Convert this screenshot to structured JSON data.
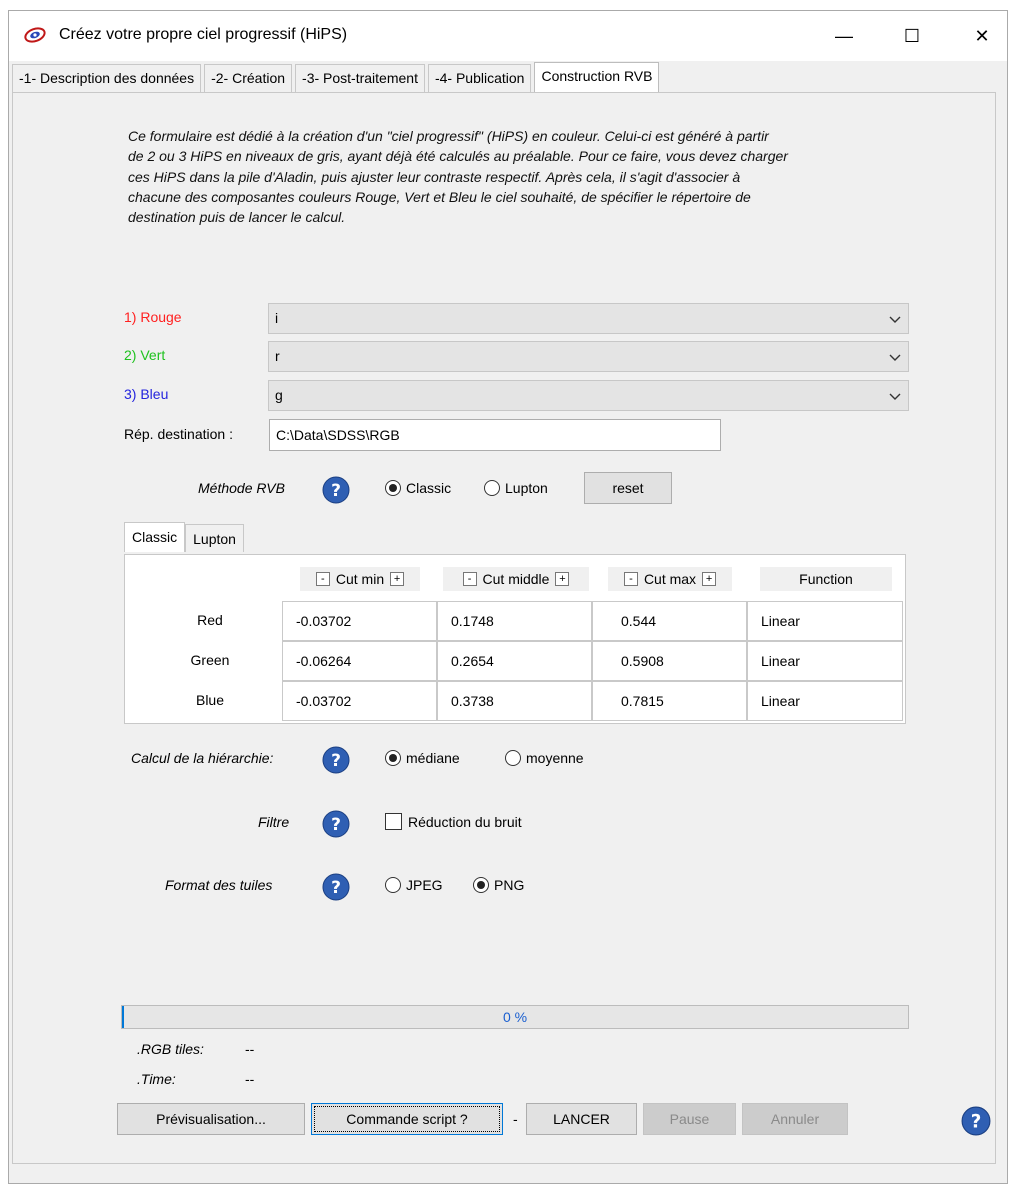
{
  "window": {
    "title": "Créez votre propre ciel progressif (HiPS)",
    "controls": {
      "minimize": "—",
      "maximize": "☐",
      "close": "✕"
    }
  },
  "tabs": [
    {
      "label": "-1- Description des données"
    },
    {
      "label": "-2- Création"
    },
    {
      "label": "-3- Post-traitement"
    },
    {
      "label": "-4- Publication"
    },
    {
      "label": "Construction RVB",
      "active": true
    }
  ],
  "description": "Ce formulaire est dédié à la création d'un \"ciel progressif\" (HiPS) en couleur. Celui-ci est généré à partir de 2 ou 3 HiPS en niveaux de gris, ayant déjà été calculés au préalable. Pour ce faire, vous devez charger ces HiPS dans la pile d'Aladin, puis ajuster leur contraste respectif. Après cela, il s'agit d'associer à chacune des composantes couleurs Rouge, Vert et Bleu le ciel souhaité, de spécifier le répertoire de destination puis de lancer le calcul.",
  "channels": {
    "red": {
      "label": "1) Rouge",
      "value": "i",
      "color": "#ff2020"
    },
    "green": {
      "label": "2) Vert",
      "value": "r",
      "color": "#1fc21f"
    },
    "blue": {
      "label": "3) Bleu",
      "value": "g",
      "color": "#2424dd"
    }
  },
  "destination": {
    "label": "Rép. destination :",
    "value": "C:\\Data\\SDSS\\RGB"
  },
  "method": {
    "label": "Méthode RVB",
    "options": [
      "Classic",
      "Lupton"
    ],
    "selected": "Classic",
    "reset_label": "reset"
  },
  "method_tabs": [
    {
      "label": "Classic",
      "active": true
    },
    {
      "label": "Lupton"
    }
  ],
  "cuts_table": {
    "columns": [
      "Cut min",
      "Cut middle",
      "Cut max",
      "Function"
    ],
    "minus": "-",
    "plus": "+",
    "rows": [
      {
        "name": "Red",
        "cut_min": "-0.03702",
        "cut_middle": "0.1748",
        "cut_max": "0.544",
        "function": "Linear"
      },
      {
        "name": "Green",
        "cut_min": "-0.06264",
        "cut_middle": "0.2654",
        "cut_max": "0.5908",
        "function": "Linear"
      },
      {
        "name": "Blue",
        "cut_min": "-0.03702",
        "cut_middle": "0.3738",
        "cut_max": "0.7815",
        "function": "Linear"
      }
    ]
  },
  "hierarchy": {
    "label": "Calcul de la hiérarchie:",
    "options": [
      "médiane",
      "moyenne"
    ],
    "selected": "médiane"
  },
  "filter": {
    "label": "Filtre",
    "checkbox_label": "Réduction du bruit",
    "checked": false
  },
  "tile_format": {
    "label": "Format des tuiles",
    "options": [
      "JPEG",
      "PNG"
    ],
    "selected": "PNG"
  },
  "progress": {
    "value": 0,
    "text": "0 %"
  },
  "stats": [
    {
      "label": ".RGB tiles:",
      "value": "--"
    },
    {
      "label": ".Time:",
      "value": "--"
    }
  ],
  "buttons": {
    "preview": "Prévisualisation...",
    "script": "Commande script ?",
    "separator": "-",
    "launch": "LANCER",
    "pause": "Pause",
    "cancel": "Annuler"
  }
}
